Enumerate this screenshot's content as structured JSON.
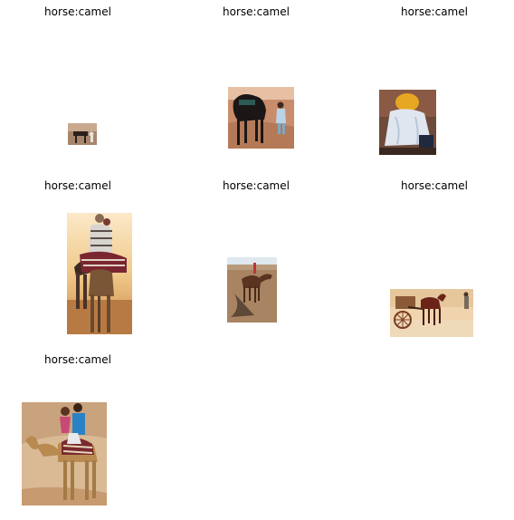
{
  "grid": {
    "cells": [
      {
        "caption": "horse:camel",
        "scene": "horse-desert-small"
      },
      {
        "caption": "horse:camel",
        "scene": "dark-horse-desert"
      },
      {
        "caption": "horse:camel",
        "scene": "rider-yellow-turban"
      },
      {
        "caption": "horse:camel",
        "scene": "camel-riders-sunset"
      },
      {
        "caption": "horse:camel",
        "scene": "camel-rider-shadow"
      },
      {
        "caption": "horse:camel",
        "scene": "horse-carriage"
      },
      {
        "caption": "horse:camel",
        "scene": "camel-two-riders"
      }
    ]
  }
}
